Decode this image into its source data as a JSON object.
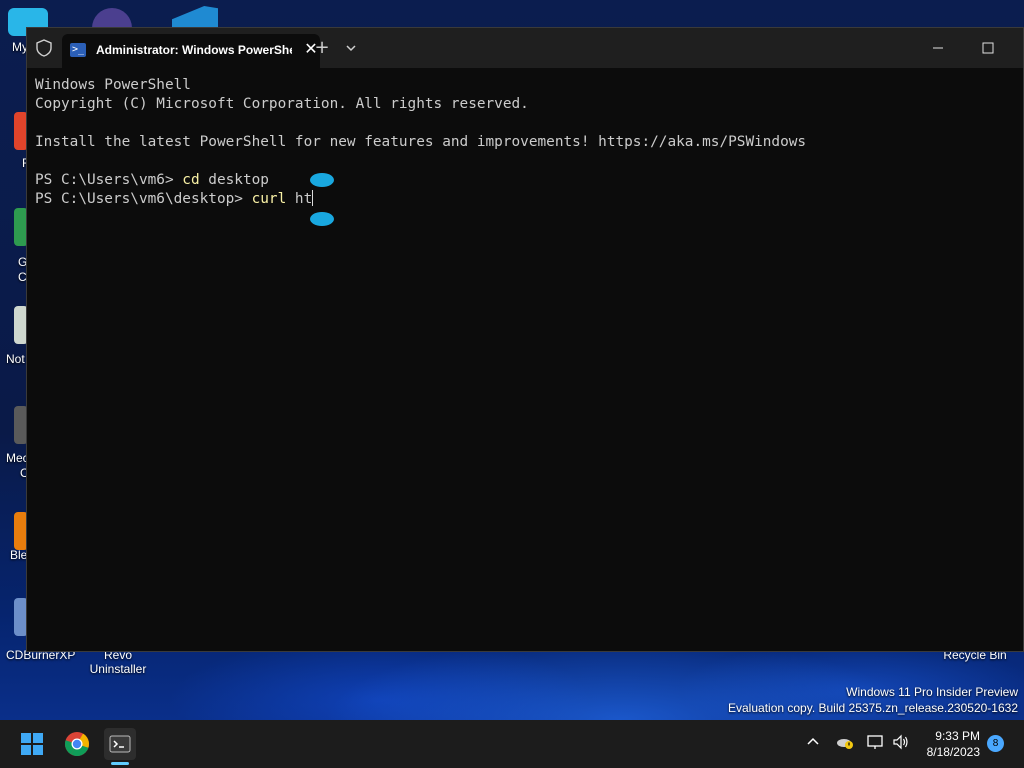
{
  "desktop": {
    "icons": [
      {
        "label": "My C"
      },
      {
        "label": "F"
      },
      {
        "label": "G"
      },
      {
        "label": "C"
      },
      {
        "label": "Not"
      },
      {
        "label": "Mec"
      },
      {
        "label": "C"
      },
      {
        "label": "Ble"
      },
      {
        "label": "CDBurnerXP"
      },
      {
        "label": "Revo Uninstaller"
      },
      {
        "label": "Recycle Bin"
      }
    ],
    "watermark": {
      "line1": "Windows 11 Pro Insider Preview",
      "line2": "Evaluation copy. Build 25375.zn_release.230520-1632"
    }
  },
  "terminal": {
    "tab_title": "Administrator: Windows PowerShell",
    "tab_icon": "powershell-icon",
    "new_tab_label": "+",
    "lines": [
      {
        "text": "Windows PowerShell"
      },
      {
        "text": "Copyright (C) Microsoft Corporation. All rights reserved."
      },
      {
        "text": ""
      },
      {
        "text": "Install the latest PowerShell for new features and improvements! https://aka.ms/PSWindows"
      },
      {
        "text": ""
      },
      {
        "prompt": "PS C:\\Users\\vm6> ",
        "command": "cd",
        "args": " desktop"
      },
      {
        "prompt": "PS C:\\Users\\vm6\\desktop> ",
        "command": "curl",
        "args": " ht"
      }
    ],
    "colors": {
      "background": "#0c0c0c",
      "text": "#cccccc",
      "command": "#f9f1a5"
    }
  },
  "taskbar": {
    "start_icon": "windows-start-icon",
    "apps": [
      "chrome-icon",
      "terminal-icon"
    ],
    "tray_icons": [
      "chevron-up-icon",
      "onedrive-warning-icon",
      "network-icon",
      "volume-icon"
    ],
    "time": "9:33 PM",
    "date": "8/18/2023",
    "notification_count": "8"
  }
}
